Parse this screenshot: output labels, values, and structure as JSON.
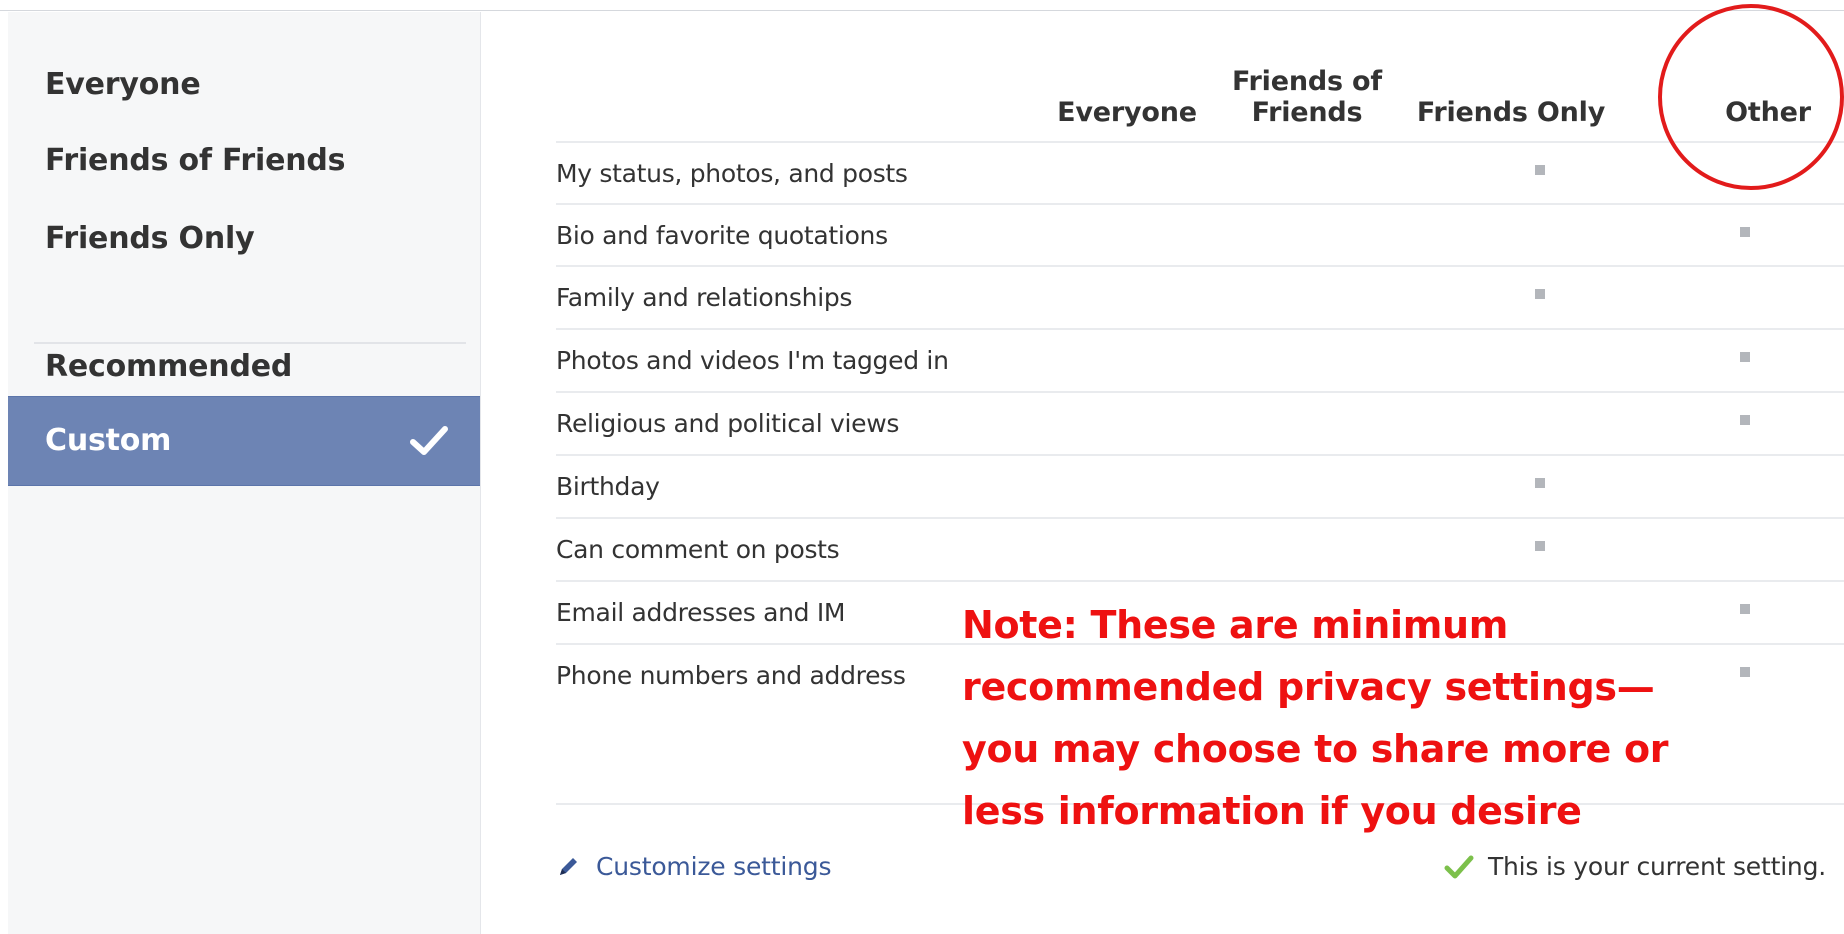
{
  "sidebar": {
    "items": [
      {
        "label": "Everyone"
      },
      {
        "label": "Friends of Friends"
      },
      {
        "label": "Friends Only"
      },
      {
        "label": "Recommended"
      },
      {
        "label": "Custom"
      }
    ],
    "selected": "Custom",
    "selected_color": "#6d84b4"
  },
  "table": {
    "columns": [
      {
        "label": "Everyone"
      },
      {
        "label": "Friends of Friends"
      },
      {
        "label": "Friends Only"
      },
      {
        "label": "Other"
      }
    ],
    "rows": [
      {
        "label": "My status, photos, and posts",
        "setting": "Friends Only"
      },
      {
        "label": "Bio and favorite quotations",
        "setting": "Other"
      },
      {
        "label": "Family and relationships",
        "setting": "Friends Only"
      },
      {
        "label": "Photos and videos I'm tagged in",
        "setting": "Other"
      },
      {
        "label": "Religious and political views",
        "setting": "Other"
      },
      {
        "label": "Birthday",
        "setting": "Friends Only"
      },
      {
        "label": "Can comment on posts",
        "setting": "Friends Only"
      },
      {
        "label": "Email addresses and IM",
        "setting": "Other"
      },
      {
        "label": "Phone numbers and address",
        "setting": "Other"
      }
    ]
  },
  "annotation": {
    "note": "Note: These are minimum recommended privacy settings— you may choose to share more or less information if you desire",
    "note_color": "#ee1111",
    "circle_color": "#e21b1b"
  },
  "footer": {
    "customize_label": "Customize settings",
    "current_setting_label": "This is your current setting."
  },
  "icons": {
    "custom_selected": "checkmark-icon",
    "customize": "pencil-icon",
    "current_setting": "green-check-icon"
  }
}
